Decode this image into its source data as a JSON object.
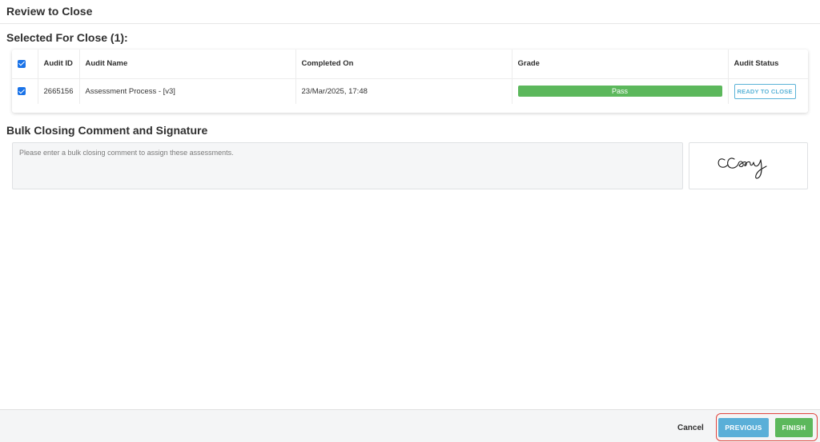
{
  "page": {
    "title": "Review to Close"
  },
  "selected": {
    "heading": "Selected For Close (1):",
    "columns": [
      "Audit ID",
      "Audit Name",
      "Completed On",
      "Grade",
      "Audit Status"
    ],
    "rows": [
      {
        "audit_id": "2665156",
        "audit_name": "Assessment Process - [v3]",
        "completed_on": "23/Mar/2025, 17:48",
        "grade": "Pass",
        "status": "READY TO CLOSE"
      }
    ]
  },
  "bulk": {
    "heading": "Bulk Closing Comment and Signature",
    "comment_placeholder": "Please enter a bulk closing comment to assign these assessments.",
    "comment_value": ""
  },
  "footer": {
    "cancel_label": "Cancel",
    "previous_label": "PREVIOUS",
    "finish_label": "FINISH"
  },
  "colors": {
    "checkbox": "#1a73e8",
    "pass": "#5cb85c",
    "status_badge": "#5bb3d7",
    "previous_button": "#5aafd8",
    "finish_button": "#5cb85c",
    "highlight_outline": "#e0463f"
  }
}
